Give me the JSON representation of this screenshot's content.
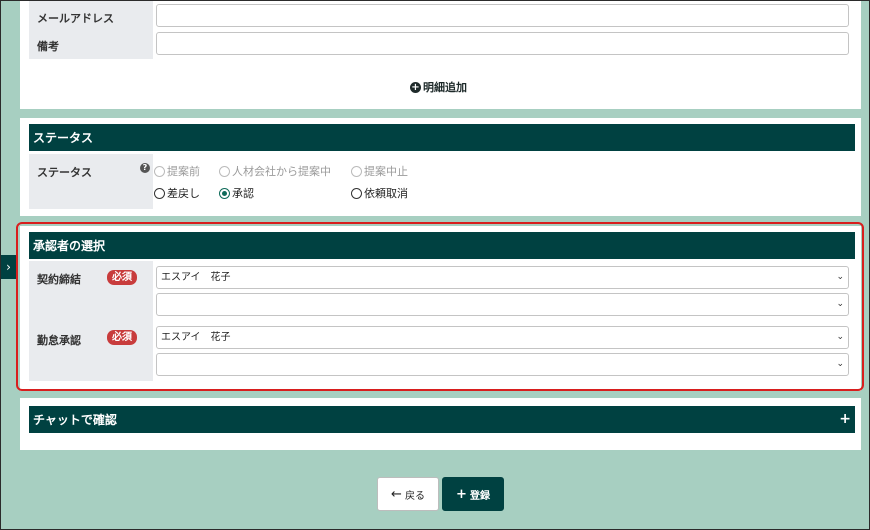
{
  "contact": {
    "email_label": "メールアドレス",
    "notes_label": "備考",
    "email_value": "",
    "notes_value": "",
    "add_detail_label": "明細追加"
  },
  "status": {
    "header": "ステータス",
    "field_label": "ステータス",
    "options": [
      {
        "label": "提案前",
        "state": "disabled"
      },
      {
        "label": "人材会社から提案中",
        "state": "disabled"
      },
      {
        "label": "提案中止",
        "state": "disabled"
      },
      {
        "label": "差戻し",
        "state": "enabled"
      },
      {
        "label": "承認",
        "state": "checked"
      },
      {
        "label": "依頼取消",
        "state": "enabled"
      }
    ]
  },
  "approver": {
    "header": "承認者の選択",
    "required_label": "必須",
    "contract": {
      "label": "契約締結",
      "selected": "エスアイ　花子",
      "second": ""
    },
    "attendance": {
      "label": "勤怠承認",
      "selected": "エスアイ　花子",
      "second": ""
    }
  },
  "chat": {
    "header": "チャットで確認",
    "toggle": "+"
  },
  "buttons": {
    "back_label": "戻る",
    "register_label": "登録"
  },
  "colors": {
    "primary": "#004141",
    "background": "#a7cfc1",
    "required": "#c83c3c",
    "highlight": "#d81e1e"
  }
}
